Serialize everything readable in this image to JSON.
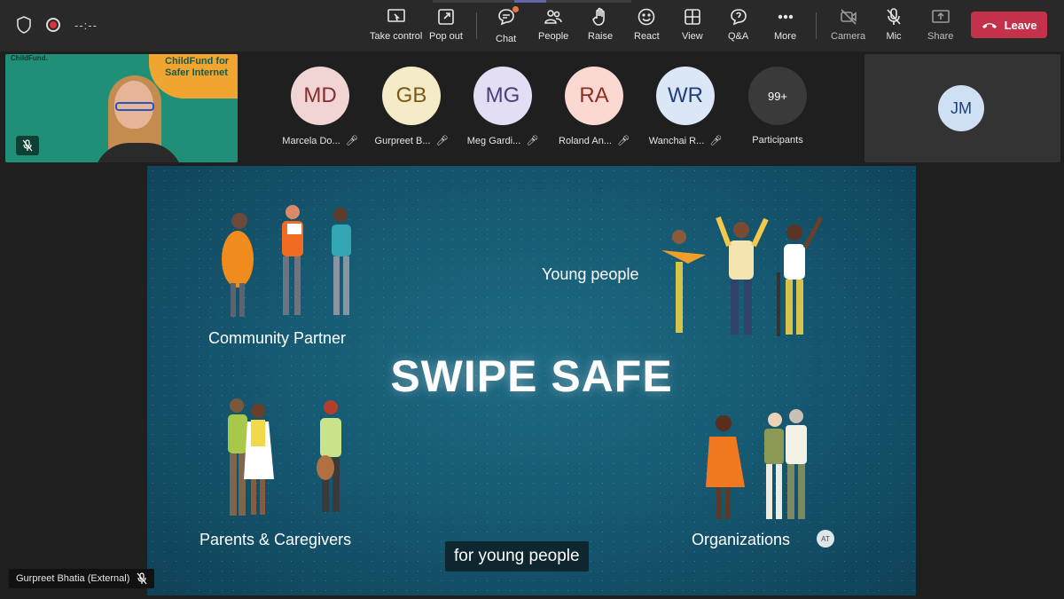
{
  "meeting": {
    "timer": "--:--"
  },
  "toolbar": {
    "take_control": "Take control",
    "pop_out": "Pop out",
    "chat": "Chat",
    "people": "People",
    "raise": "Raise",
    "react": "React",
    "view": "View",
    "qa": "Q&A",
    "more": "More",
    "camera": "Camera",
    "mic": "Mic",
    "share": "Share",
    "leave": "Leave"
  },
  "self_view": {
    "banner_text": "ChildFund for Safer Internet",
    "logo_text": "ChildFund."
  },
  "participants": [
    {
      "initials": "MD",
      "name": "Marcela Do...",
      "bg": "#f1d5d5",
      "fg": "#8a2c2c"
    },
    {
      "initials": "GB",
      "name": "Gurpreet B...",
      "bg": "#f6ebc8",
      "fg": "#7a5a12"
    },
    {
      "initials": "MG",
      "name": "Meg Gardi...",
      "bg": "#e3def3",
      "fg": "#4a3f7a"
    },
    {
      "initials": "RA",
      "name": "Roland An...",
      "bg": "#fbd9d2",
      "fg": "#8d2e22"
    },
    {
      "initials": "WR",
      "name": "Wanchai R...",
      "bg": "#dbe6f7",
      "fg": "#203f7a"
    }
  ],
  "overflow": {
    "count": "99+",
    "label": "Participants"
  },
  "pinned": {
    "initials": "JM"
  },
  "slide": {
    "title": "SWIPE SAFE",
    "labels": {
      "community": "Community Partner",
      "young": "Young people",
      "parents": "Parents & Caregivers",
      "orgs": "Organizations"
    },
    "caption": "for young people",
    "badge": "AT"
  },
  "speaker": {
    "name": "Gurpreet Bhatia (External)"
  },
  "colors": {
    "leave": "#c4314b",
    "accent": "#6264a7",
    "slide_bg": "#165a73"
  }
}
